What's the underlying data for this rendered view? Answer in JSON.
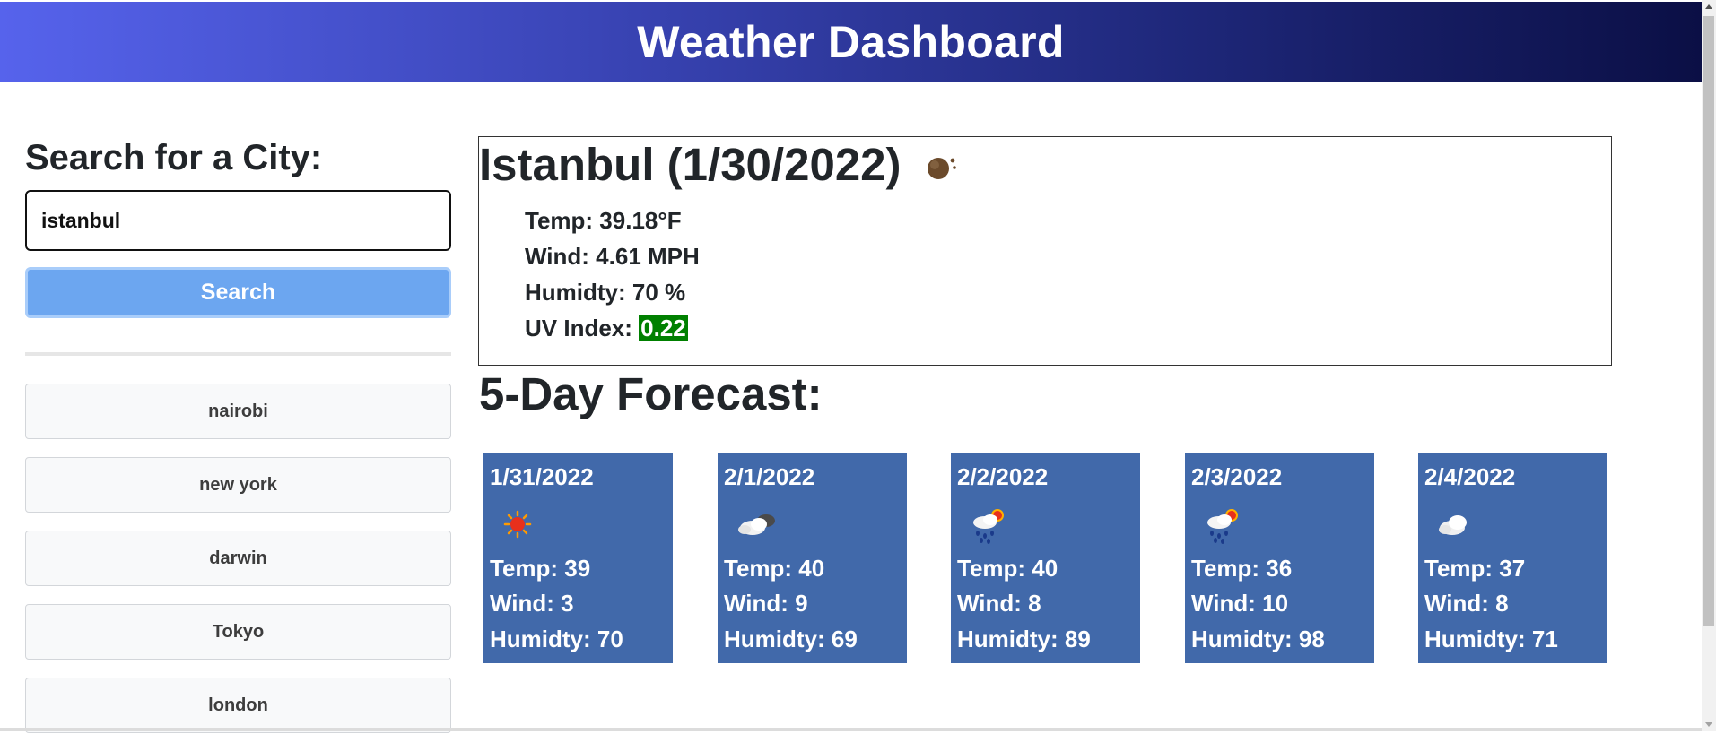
{
  "header": {
    "title": "Weather Dashboard"
  },
  "search": {
    "title": "Search for a City:",
    "input_value": "istanbul",
    "button_label": "Search"
  },
  "history": [
    "nairobi",
    "new york",
    "darwin",
    "Tokyo",
    "london"
  ],
  "current": {
    "title": "Istanbul (1/30/2022)",
    "icon": "moon-clouds-icon",
    "temp": "Temp: 39.18°F",
    "wind": "Wind: 4.61 MPH",
    "humidity": "Humidty: 70 %",
    "uv_label": "UV Index:",
    "uv_value": "0.22",
    "uv_color": "#008000"
  },
  "forecast": {
    "title": "5-Day Forecast:",
    "days": [
      {
        "date": "1/31/2022",
        "icon": "sun-icon",
        "temp": "Temp: 39",
        "wind": "Wind: 3",
        "humidity": "Humidty: 70"
      },
      {
        "date": "2/1/2022",
        "icon": "dark-clouds-icon",
        "temp": "Temp: 40",
        "wind": "Wind: 9",
        "humidity": "Humidty: 69"
      },
      {
        "date": "2/2/2022",
        "icon": "sun-rain-icon",
        "temp": "Temp: 40",
        "wind": "Wind: 8",
        "humidity": "Humidty: 89"
      },
      {
        "date": "2/3/2022",
        "icon": "sun-rain-icon",
        "temp": "Temp: 36",
        "wind": "Wind: 10",
        "humidity": "Humidty: 98"
      },
      {
        "date": "2/4/2022",
        "icon": "cloud-icon",
        "temp": "Temp: 37",
        "wind": "Wind: 8",
        "humidity": "Humidty: 71"
      }
    ]
  },
  "colors": {
    "header_gradient_start": "#5663ec",
    "header_gradient_end": "#0b0f45",
    "search_button": "#6ca6f0",
    "forecast_card": "#4169aa"
  }
}
